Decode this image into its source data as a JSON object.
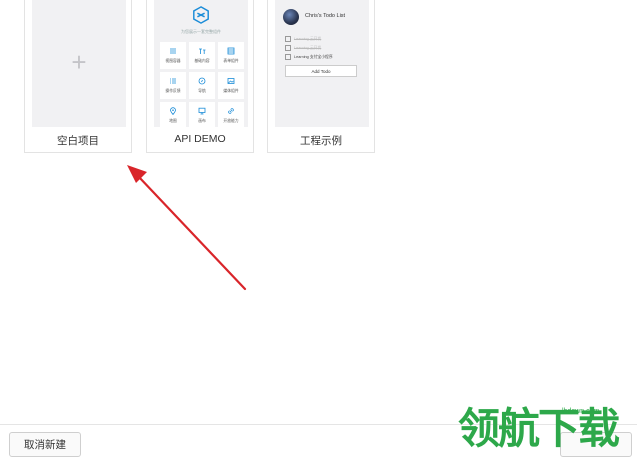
{
  "templates": [
    {
      "name": "空白项目"
    },
    {
      "name": "API DEMO",
      "subtitle": "为您展示一套完整组件",
      "tiles": [
        {
          "label": "视图容器",
          "icon": "list-icon"
        },
        {
          "label": "基础内容",
          "icon": "text-icon"
        },
        {
          "label": "表单组件",
          "icon": "form-icon"
        },
        {
          "label": "操作反馈",
          "icon": "menu-icon"
        },
        {
          "label": "导航",
          "icon": "compass-icon"
        },
        {
          "label": "媒体组件",
          "icon": "image-icon"
        },
        {
          "label": "地图",
          "icon": "location-icon"
        },
        {
          "label": "画布",
          "icon": "canvas-icon"
        },
        {
          "label": "开放能力",
          "icon": "link-icon"
        }
      ]
    },
    {
      "name": "工程示例",
      "todo_title": "Chris's Todo List",
      "todo_items": [
        {
          "text": "Learning 云开发",
          "done": true
        },
        {
          "text": "Learning 云开发",
          "done": true
        },
        {
          "text": "Learning 支付宝小程序",
          "done": false
        }
      ],
      "add_button": "Add Todo"
    }
  ],
  "footer": {
    "cancel_label": "取消新建"
  },
  "watermark": {
    "text": "领航下载",
    "url": "lhdown.com"
  },
  "colors": {
    "arrow": "#d9252a",
    "watermark": "#2da84a",
    "api_accent": "#1a8cd8"
  }
}
